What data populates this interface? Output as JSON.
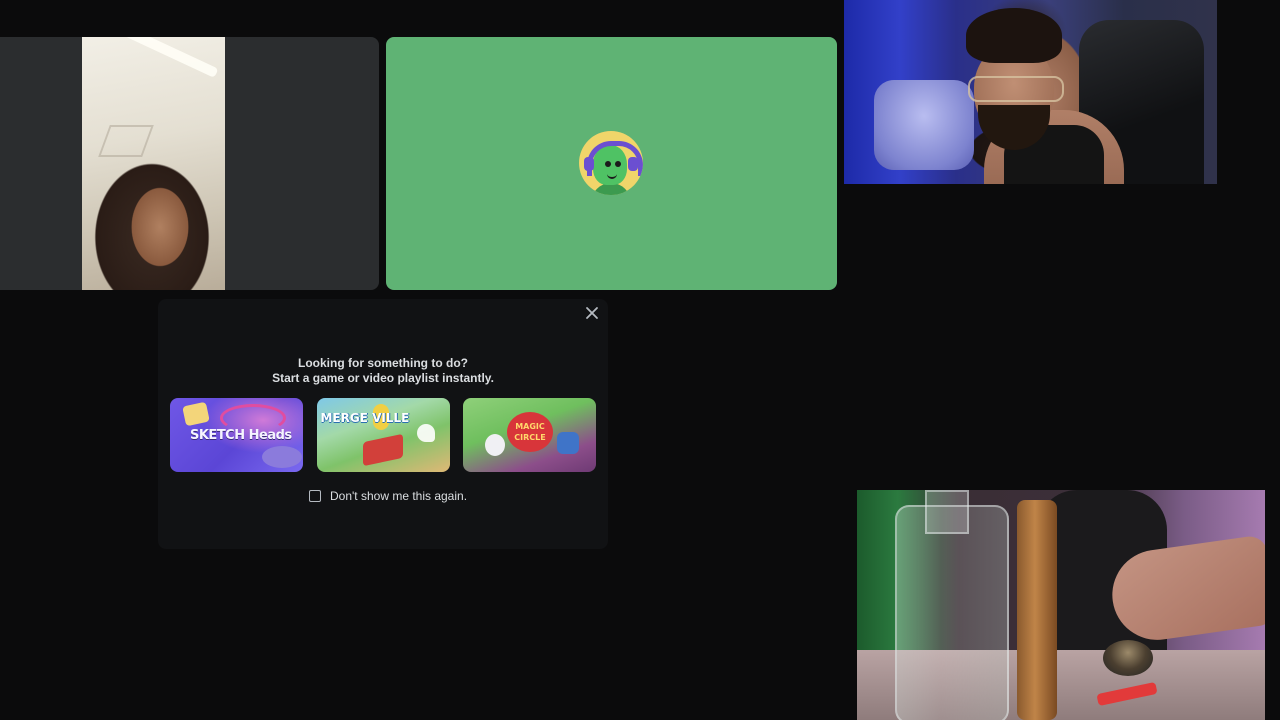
{
  "activity_prompt": {
    "heading_line1": "Looking for something to do?",
    "heading_line2": "Start a game or video playlist instantly.",
    "close_icon": "close-icon",
    "activities": [
      {
        "logo_text": "SKETCH Heads"
      },
      {
        "logo_text": "MERGE VILLE"
      },
      {
        "logo_text": "MAGIC CIRCLE"
      }
    ],
    "dont_show_label": "Don't show me this again.",
    "dont_show_checked": false
  },
  "colors": {
    "popup_bg": "#111214",
    "avatar_tile_bg": "#5fb374",
    "video_tile_bg": "#2b2d2f",
    "text_primary": "#dbdee1"
  }
}
